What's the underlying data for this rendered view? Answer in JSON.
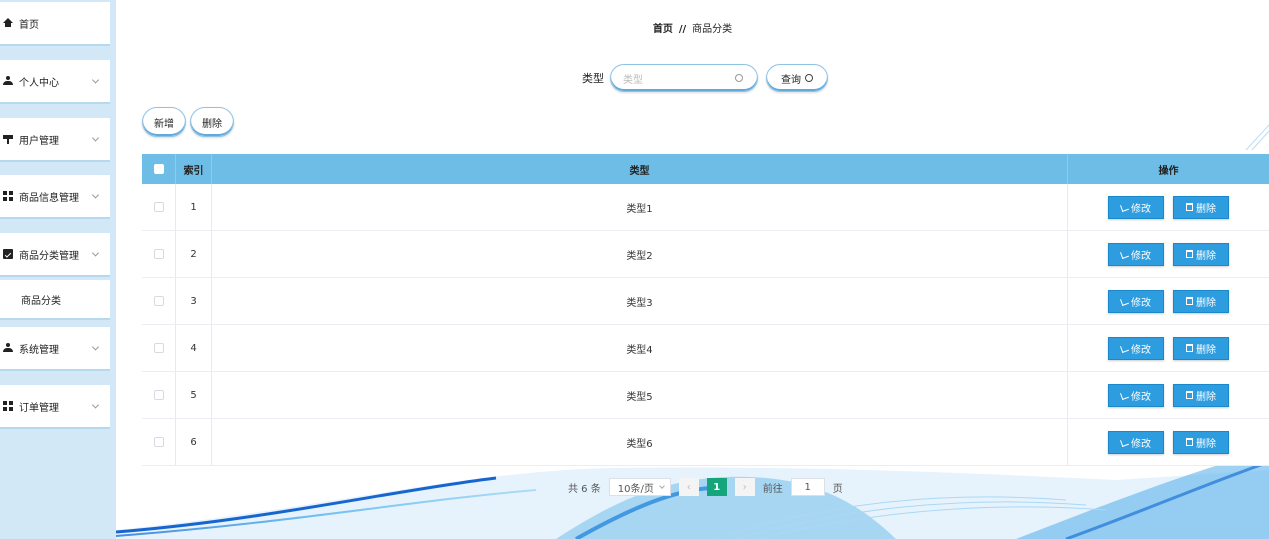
{
  "sidebar": {
    "items": [
      {
        "label": "首页",
        "icon": "home-icon"
      },
      {
        "label": "个人中心",
        "icon": "user-icon"
      },
      {
        "label": "用户管理",
        "icon": "flag-icon"
      },
      {
        "label": "商品信息管理",
        "icon": "grid-icon"
      },
      {
        "label": "商品分类管理",
        "icon": "clipboard-icon"
      },
      {
        "label": "系统管理",
        "icon": "user-icon"
      },
      {
        "label": "订单管理",
        "icon": "grid-icon"
      }
    ],
    "submenu_item": "商品分类"
  },
  "breadcrumb": {
    "home": "首页",
    "separator": "//",
    "current": "商品分类"
  },
  "search": {
    "label": "类型",
    "placeholder": "类型",
    "query_button": "查询"
  },
  "actions": {
    "add": "新增",
    "delete": "删除"
  },
  "table": {
    "columns": {
      "index": "索引",
      "type": "类型",
      "ops": "操作"
    },
    "rows": [
      {
        "index": "1",
        "type": "类型1"
      },
      {
        "index": "2",
        "type": "类型2"
      },
      {
        "index": "3",
        "type": "类型3"
      },
      {
        "index": "4",
        "type": "类型4"
      },
      {
        "index": "5",
        "type": "类型5"
      },
      {
        "index": "6",
        "type": "类型6"
      }
    ],
    "edit_label": "修改",
    "delete_label": "删除"
  },
  "pagination": {
    "total": "共 6 条",
    "page_size": "10条/页",
    "current_page": "1",
    "goto_prefix": "前往",
    "goto_value": "1",
    "goto_suffix": "页"
  },
  "colors": {
    "header": "#6dbde6",
    "button": "#2d9de0",
    "page_active": "#15a57a",
    "sidebar_bg": "#d2e8f6"
  }
}
